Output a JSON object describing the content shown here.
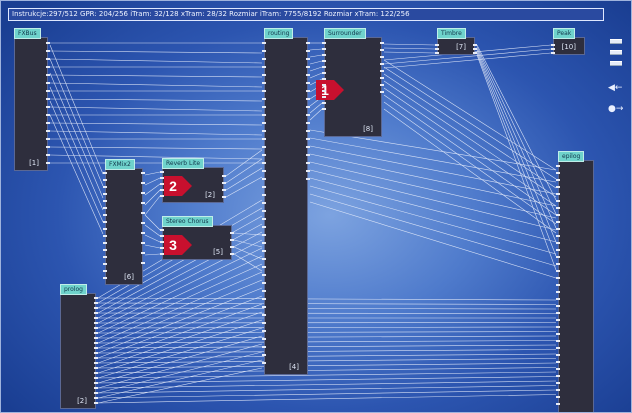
{
  "status_bar": "Instrukcje:297/512 GPR: 204/256 iTram: 32/128 xTram: 28/32 Rozmiar iTram: 7755/8192 Rozmiar xTram: 122/256",
  "blocks": [
    {
      "id": "fxbus",
      "title": "FXBus",
      "index": "[1]"
    },
    {
      "id": "fxmix2",
      "title": "FXMix2",
      "index": "[6]"
    },
    {
      "id": "reverb",
      "title": "Reverb Lite",
      "index": "[2]"
    },
    {
      "id": "chorus",
      "title": "Stereo Chorus",
      "index": "[5]"
    },
    {
      "id": "prolog",
      "title": "prolog",
      "index": "[2]"
    },
    {
      "id": "routing",
      "title": "routing",
      "index": "[4]"
    },
    {
      "id": "surrounder",
      "title": "Surrounder",
      "index": "[8]"
    },
    {
      "id": "timbre",
      "title": "Timbre",
      "index": "[7]"
    },
    {
      "id": "peak",
      "title": "Peak",
      "index": "[10]"
    },
    {
      "id": "epilog",
      "title": "epilog",
      "index": ""
    }
  ],
  "markers": [
    "1",
    "2",
    "3"
  ],
  "colors": {
    "accent_title": "#6fd3cc",
    "marker": "#c8102e",
    "block": "#2e2e3d",
    "wire": "#e8eefc"
  },
  "icons": {
    "side_buttons": [
      "menu-line-icon",
      "menu-line-icon",
      "menu-line-icon"
    ],
    "side_tools": [
      "speaker-icon",
      "plug-icon"
    ]
  }
}
